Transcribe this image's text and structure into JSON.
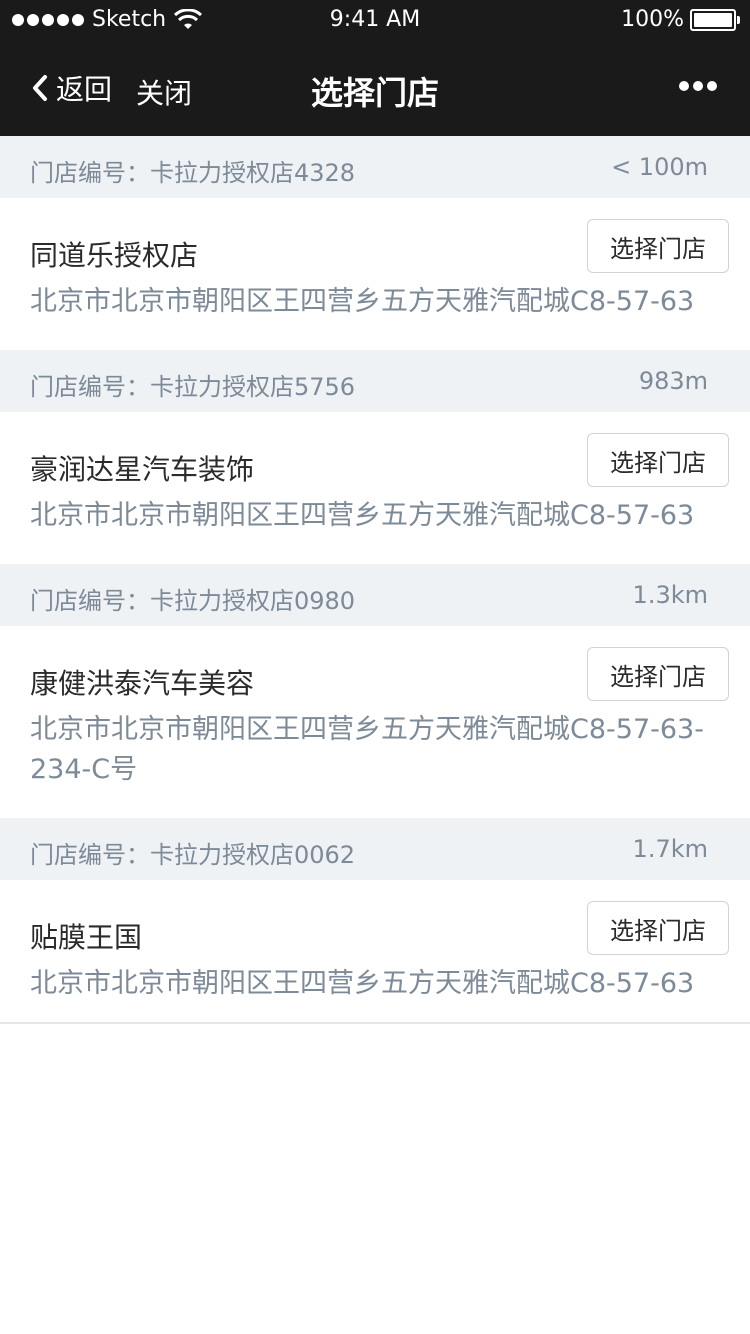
{
  "status_bar": {
    "carrier": "Sketch",
    "time": "9:41 AM",
    "battery": "100%"
  },
  "nav": {
    "back_label": "返回",
    "close_label": "关闭",
    "title": "选择门店"
  },
  "stores": [
    {
      "code": "门店编号：卡拉力授权店4328",
      "distance": "< 100m",
      "name": "同道乐授权店",
      "address": "北京市北京市朝阳区王四营乡五方天雅汽配城C8-57-63",
      "button": "选择门店"
    },
    {
      "code": "门店编号：卡拉力授权店5756",
      "distance": "983m",
      "name": "豪润达星汽车装饰",
      "address": "北京市北京市朝阳区王四营乡五方天雅汽配城C8-57-63",
      "button": "选择门店"
    },
    {
      "code": "门店编号：卡拉力授权店0980",
      "distance": "1.3km",
      "name": "康健洪泰汽车美容",
      "address": "北京市北京市朝阳区王四营乡五方天雅汽配城C8-57-63-234-C号",
      "button": "选择门店"
    },
    {
      "code": "门店编号：卡拉力授权店0062",
      "distance": "1.7km",
      "name": "贴膜王国",
      "address": "北京市北京市朝阳区王四营乡五方天雅汽配城C8-57-63",
      "button": "选择门店"
    }
  ]
}
